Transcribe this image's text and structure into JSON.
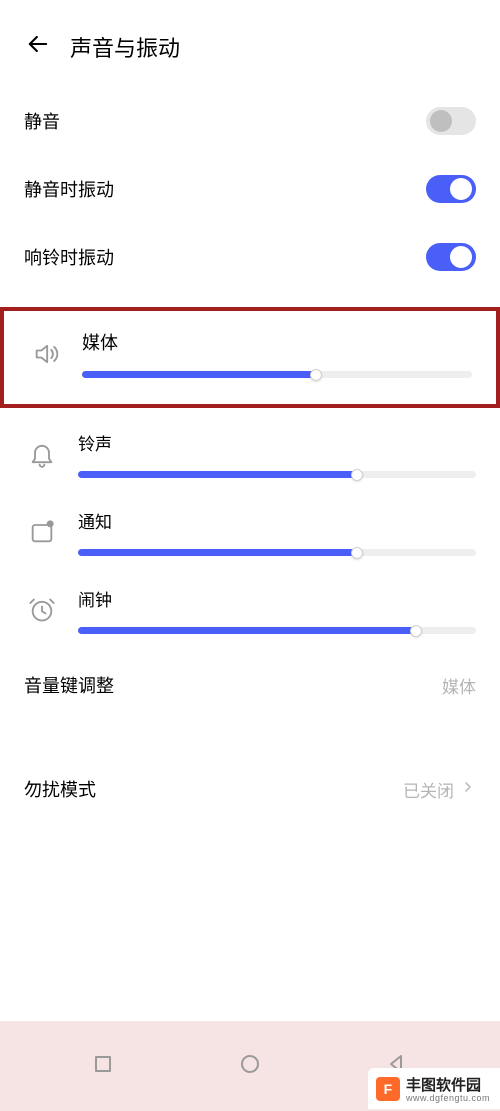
{
  "header": {
    "title": "声音与振动"
  },
  "toggles": {
    "mute": {
      "label": "静音",
      "on": false
    },
    "vibrate_on_mute": {
      "label": "静音时振动",
      "on": true
    },
    "vibrate_on_ring": {
      "label": "响铃时振动",
      "on": true
    }
  },
  "sliders": {
    "media": {
      "label": "媒体",
      "icon": "speaker-icon",
      "value": 60
    },
    "ringtone": {
      "label": "铃声",
      "icon": "bell-icon",
      "value": 70
    },
    "notification": {
      "label": "通知",
      "icon": "notification-icon",
      "value": 70
    },
    "alarm": {
      "label": "闹钟",
      "icon": "alarm-icon",
      "value": 85
    }
  },
  "links": {
    "volume_key": {
      "label": "音量键调整",
      "value": "媒体"
    },
    "dnd": {
      "label": "勿扰模式",
      "value": "已关闭"
    }
  },
  "watermark": {
    "badge": "F",
    "text": "丰图软件园",
    "sub": "www.dgfengtu.com"
  }
}
